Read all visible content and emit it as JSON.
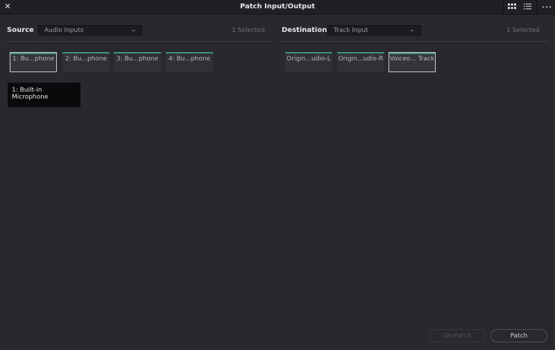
{
  "window": {
    "title": "Patch Input/Output",
    "close_icon": "close-icon",
    "view_icons": [
      "grid-view-icon",
      "list-view-icon",
      "more-options-icon"
    ]
  },
  "source": {
    "label": "Source",
    "dropdown": "Audio Inputs",
    "selected_count": "1 Selected",
    "tiles": [
      "1: Bu...phone",
      "2: Bu...phone",
      "3: Bu...phone",
      "4: Bu...phone"
    ],
    "tooltip": "1: Built-in Microphone"
  },
  "destination": {
    "label": "Destination",
    "dropdown": "Track Input",
    "selected_count": "1 Selected",
    "tiles": [
      "Origin...udio-L",
      "Origin...udio-R",
      "Voiceo... Track"
    ]
  },
  "buttons": {
    "unpatch": "Un-Patch",
    "patch": "Patch"
  },
  "colors": {
    "accent": "#3a9a82",
    "background": "#28282e"
  }
}
